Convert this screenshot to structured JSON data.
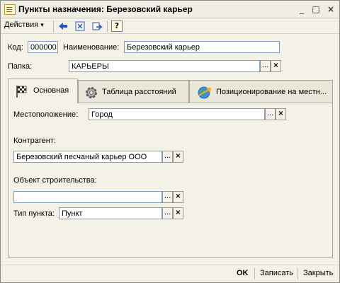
{
  "window": {
    "title": "Пункты назначения: Березовский карьер"
  },
  "toolbar": {
    "actions_label": "Действия",
    "help": "?"
  },
  "form": {
    "code_label": "Код:",
    "code_value": "000000",
    "name_label": "Наименование:",
    "name_value": "Березовский карьер",
    "folder_label": "Папка:",
    "folder_value": "КАРЬЕРЫ"
  },
  "tabs": [
    {
      "label": "Основная",
      "icon": "checkered-flag-icon"
    },
    {
      "label": "Таблица расстояний",
      "icon": "gear-icon"
    },
    {
      "label": "Позиционирование на местн...",
      "icon": "globe-arrow-icon"
    }
  ],
  "main": {
    "location_label": "Местоположение:",
    "location_value": "Город",
    "counterparty_label": "Контрагент:",
    "counterparty_value": "Березовский песчаный карьер ООО",
    "construction_label": "Объект строительства:",
    "construction_value": "",
    "point_type_label": "Тип пункта:",
    "point_type_value": "Пункт"
  },
  "buttons": {
    "ok": "OK",
    "save": "Записать",
    "close": "Закрыть"
  },
  "glyphs": {
    "select": "...",
    "clear": "×",
    "minimize": "_",
    "maximize": "□",
    "close": "×",
    "dropdown": "▾"
  }
}
